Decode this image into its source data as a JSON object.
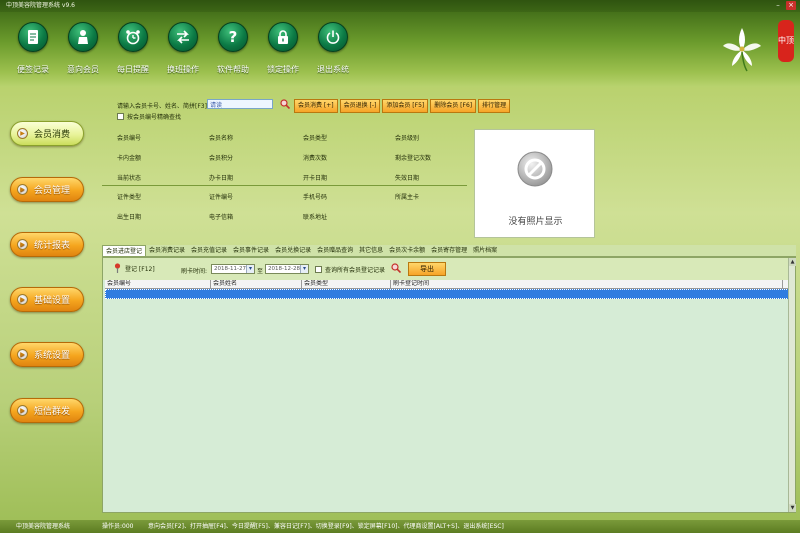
{
  "window": {
    "title": "中顶美容院管理系统 v9.6"
  },
  "toolbar": {
    "items": [
      {
        "label": "便签记录",
        "icon": "notepad-icon"
      },
      {
        "label": "意向会员",
        "icon": "member-icon"
      },
      {
        "label": "每日提醒",
        "icon": "alarm-clock-icon"
      },
      {
        "label": "换班操作",
        "icon": "shift-arrows-icon"
      },
      {
        "label": "软件帮助",
        "icon": "help-icon"
      },
      {
        "label": "锁定操作",
        "icon": "lock-icon"
      },
      {
        "label": "退出系统",
        "icon": "power-icon"
      }
    ]
  },
  "logo": {
    "seal_text": "中顶"
  },
  "sidebar": {
    "items": [
      {
        "label": "会员消费",
        "active": true
      },
      {
        "label": "会员管理",
        "active": false
      },
      {
        "label": "统计报表",
        "active": false
      },
      {
        "label": "基础设置",
        "active": false
      },
      {
        "label": "系统设置",
        "active": false
      },
      {
        "label": "短信群发",
        "active": false
      }
    ]
  },
  "search": {
    "label": "请输入会员卡号、姓名、简拼[F3]",
    "value": "请读",
    "precise_label": "按会员编号精确查找",
    "precise_checked": false
  },
  "actions": {
    "buttons": [
      "会员消费 [+]",
      "会员退换 [-]",
      "添加会员 [F5]",
      "删除会员 [F6]",
      "排行管理"
    ]
  },
  "info_fields": {
    "group1": [
      "会员编号",
      "会员名称",
      "会员类型",
      "会员级别",
      "卡内金额",
      "会员积分",
      "消费次数",
      "剩余登记次数",
      "当前状态",
      "办卡日期",
      "开卡日期",
      "失效日期"
    ],
    "group2": [
      "证件类型",
      "证件编号",
      "手机号码",
      "所属主卡",
      "出生日期",
      "电子信箱",
      "联系地址"
    ]
  },
  "photo": {
    "placeholder": "没有照片显示"
  },
  "tabs": {
    "items": [
      "会员进店登记",
      "会员消费记录",
      "会员充值记录",
      "会员事件记录",
      "会员兑换记录",
      "会员赠品查询",
      "其它信息",
      "会员次卡余额",
      "会员寄存管理",
      "照片档案"
    ],
    "active_index": 0
  },
  "filter": {
    "register_label": "登记 [F12]",
    "date_label": "刷卡时间:",
    "date_from": "2018-11-27",
    "date_to_sep": "至",
    "date_to": "2018-12-28",
    "query_all_label": "查询所有会员登记记录",
    "query_all_checked": false,
    "export_label": "导出"
  },
  "table": {
    "columns": [
      "会员编号",
      "会员姓名",
      "会员类型",
      "刷卡登记时间"
    ],
    "rows": []
  },
  "statusbar": {
    "app_name": "中顶美容院管理系统",
    "operator": "操作员:000",
    "shortcuts": "意向会员[F2]、打开抽屉[F4]、今日提醒[F5]、兼容日记[F7]、切换登录[F9]、锁定屏幕[F10]、代理商设置[ALT+S]、退出系统[ESC]"
  },
  "colors": {
    "header_green": "#6b9b2c",
    "orange_button": "#f5a51e",
    "selected_row": "#2f7ce0",
    "content_bg": "#d6ecd6"
  }
}
